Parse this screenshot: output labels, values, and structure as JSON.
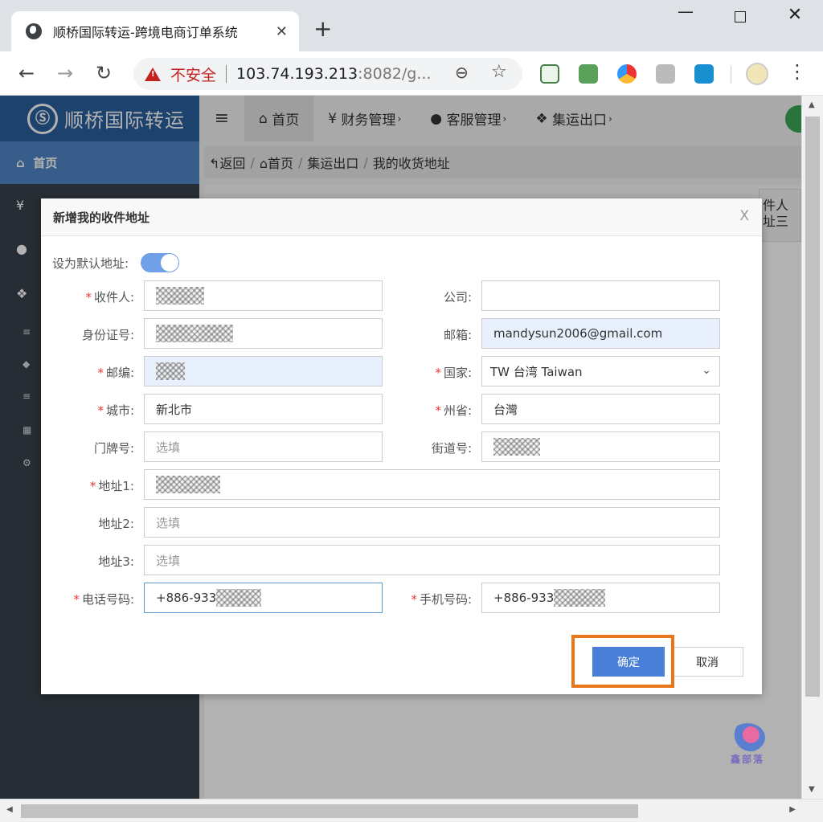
{
  "browser": {
    "tab_title": "顺桥国际转运-跨境电商订单系统",
    "tab_close": "✕",
    "new_tab": "+",
    "security_label": "不安全",
    "url_host": "103.74.193.213",
    "url_rest": ":8082/g...",
    "win_min": "—",
    "win_close": "✕"
  },
  "app": {
    "logo_text": "顺桥国际转运",
    "nav": [
      {
        "label": "首页",
        "icon": "home-icon",
        "active": true
      },
      {
        "label": "财务管理",
        "icon": "yen-icon"
      },
      {
        "label": "客服管理",
        "icon": "user-icon"
      },
      {
        "label": "集运出口",
        "icon": "boxes-icon"
      }
    ],
    "sidebar": {
      "home": "首页",
      "icons": [
        "yen-icon",
        "user-icon",
        "boxes-icon",
        "list-icon",
        "cube-icon",
        "align-icon",
        "grid-icon",
        "gear-icon"
      ]
    },
    "breadcrumb": {
      "back": "返回",
      "home": "首页",
      "section": "集运出口",
      "current": "我的收货地址"
    },
    "background_column": [
      "件人",
      "址三"
    ]
  },
  "modal": {
    "title": "新增我的收件地址",
    "close": "X",
    "default_label": "设为默认地址:",
    "default_on": true,
    "fields": {
      "recipient_label": "收件人:",
      "company_label": "公司:",
      "id_label": "身份证号:",
      "email_label": "邮箱:",
      "email_value": "mandysun2006@gmail.com",
      "zip_label": "邮编:",
      "country_label": "国家:",
      "country_value": "TW 台湾 Taiwan",
      "city_label": "城市:",
      "city_value": "新北市",
      "state_label": "州省:",
      "state_value": "台灣",
      "door_label": "门牌号:",
      "door_placeholder": "选填",
      "street_label": "街道号:",
      "addr1_label": "地址1:",
      "addr2_label": "地址2:",
      "addr2_placeholder": "选填",
      "addr3_label": "地址3:",
      "addr3_placeholder": "选填",
      "phone_label": "电话号码:",
      "phone_value": "+886-933",
      "mobile_label": "手机号码:",
      "mobile_value": "+886-933"
    },
    "required_mark": "*",
    "ok_label": "确定",
    "cancel_label": "取消"
  },
  "watermark": "鑫部落",
  "colors": {
    "brand": "#2c5f9e",
    "primary_button": "#4a7fd8",
    "highlight": "#e8761b",
    "required": "#e33333"
  }
}
